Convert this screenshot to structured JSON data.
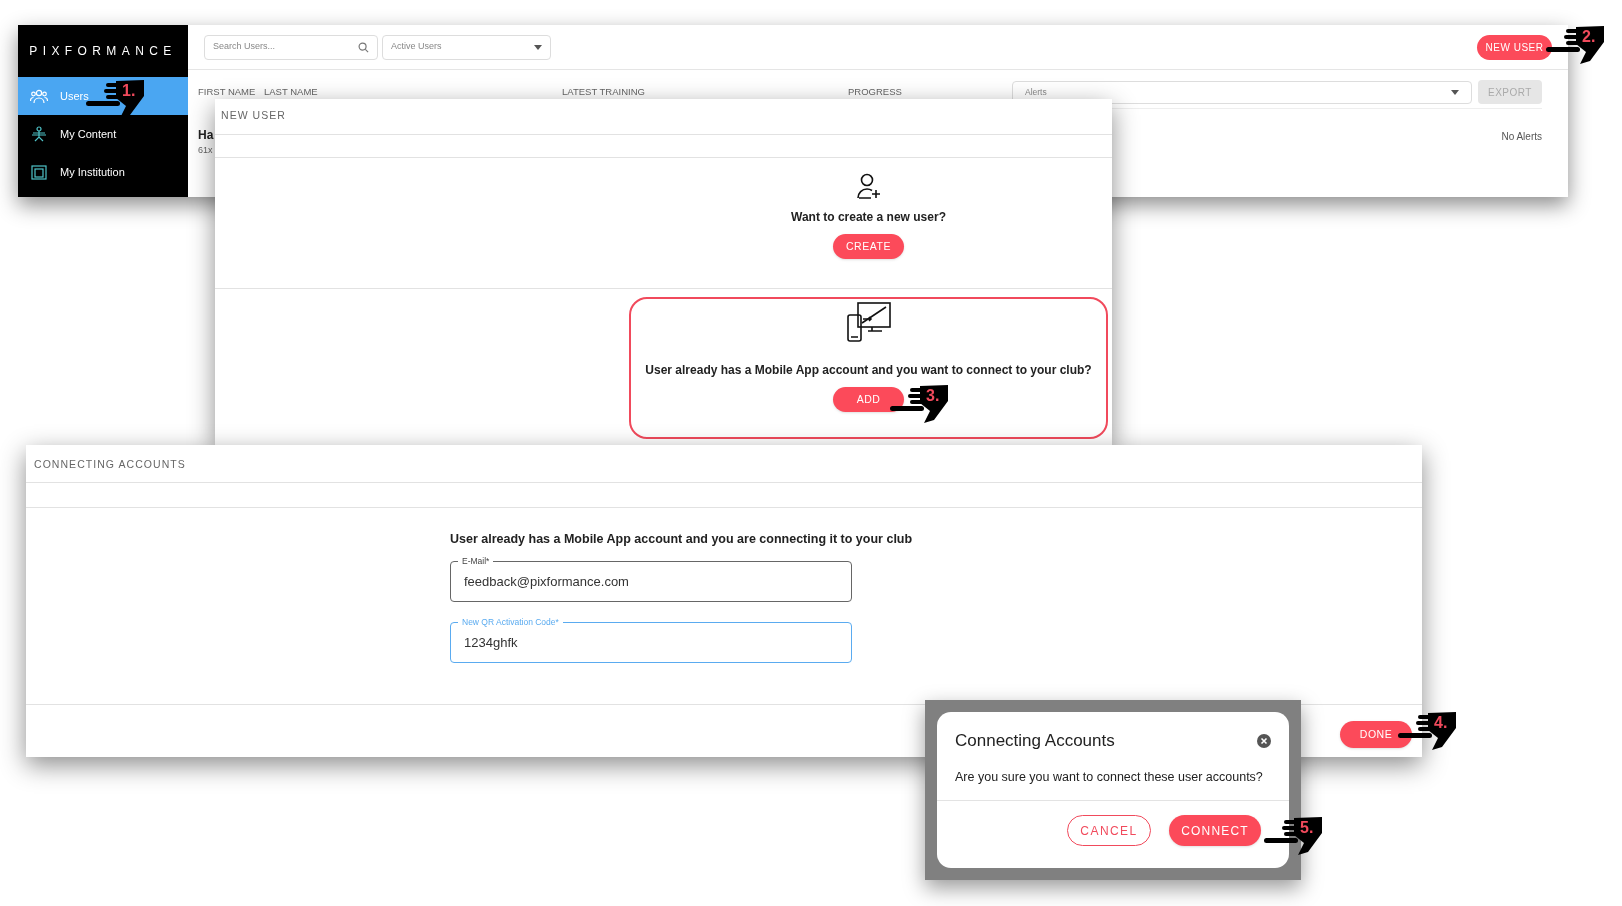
{
  "main_window": {
    "logo": "PIXFORMANCE",
    "sidebar": [
      {
        "label": "Users",
        "selected": true
      },
      {
        "label": "My Content",
        "selected": false
      },
      {
        "label": "My Institution",
        "selected": false
      }
    ],
    "search": {
      "placeholder": "Search Users..."
    },
    "filter": {
      "value": "Active Users"
    },
    "new_user_button": "NEW USER",
    "columns": [
      "FIRST NAME",
      "LAST NAME",
      "LATEST TRAINING",
      "PROGRESS"
    ],
    "row": {
      "name": "Ha",
      "detail": "61x"
    },
    "alerts_select": {
      "placeholder": "Alerts"
    },
    "export_button": {
      "label": "EXPORT",
      "disabled": true
    },
    "alerts_empty": "No Alerts"
  },
  "new_user_dialog": {
    "title": "NEW USER",
    "options": [
      {
        "kind": "create",
        "question": "Want to create a new user?",
        "button": "CREATE",
        "highlighted": false
      },
      {
        "kind": "connect",
        "question": "User already has a Mobile App account and you want to connect to your club?",
        "button": "ADD",
        "highlighted": true
      }
    ]
  },
  "connecting_dialog": {
    "title": "CONNECTING ACCOUNTS",
    "heading": "User already has a Mobile App account and you are connecting it to your club",
    "fields": [
      {
        "label": "E-Mail*",
        "value": "feedback@pixformance.com",
        "focused": false
      },
      {
        "label": "New QR Activation Code*",
        "value": "1234ghfk",
        "focused": true
      }
    ],
    "done_button": "DONE"
  },
  "confirm_dialog": {
    "title": "Connecting Accounts",
    "message": "Are you sure you want to connect these user accounts?",
    "cancel_button": "CANCEL",
    "confirm_button": "CONNECT"
  },
  "annotations": [
    "1.",
    "2.",
    "3.",
    "4.",
    "5."
  ]
}
